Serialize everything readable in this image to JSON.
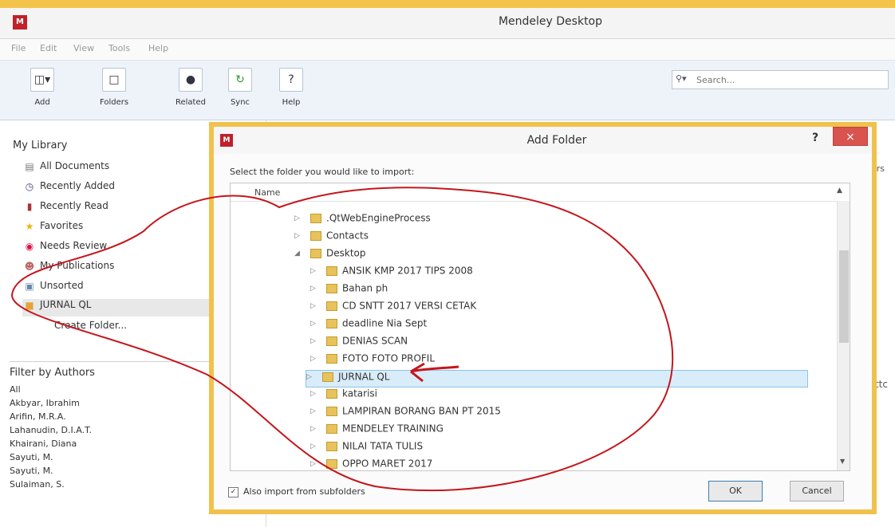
{
  "window": {
    "title": "Mendeley Desktop",
    "logo": "M"
  },
  "menu": [
    "File",
    "Edit",
    "View",
    "Tools",
    "Help"
  ],
  "toolbar": {
    "buttons": [
      {
        "label": "Add",
        "icon": "add-document-icon"
      },
      {
        "label": "Folders",
        "icon": "folder-icon"
      },
      {
        "label": "Related",
        "icon": "related-icon"
      },
      {
        "label": "Sync",
        "icon": "sync-icon"
      },
      {
        "label": "Help",
        "icon": "help-icon"
      }
    ],
    "search_placeholder": "Search..."
  },
  "sidebar": {
    "title": "My Library",
    "items": [
      {
        "label": "All Documents",
        "icon": "documents-icon"
      },
      {
        "label": "Recently Added",
        "icon": "clock-icon"
      },
      {
        "label": "Recently Read",
        "icon": "book-icon"
      },
      {
        "label": "Favorites",
        "icon": "star-icon"
      },
      {
        "label": "Needs Review",
        "icon": "review-icon"
      },
      {
        "label": "My Publications",
        "icon": "person-icon"
      },
      {
        "label": "Unsorted",
        "icon": "unsorted-icon"
      },
      {
        "label": "JURNAL QL",
        "icon": "folder-icon",
        "selected": true
      },
      {
        "label": "Create Folder...",
        "icon": ""
      }
    ]
  },
  "filter": {
    "title": "Filter by Authors",
    "authors": [
      "All",
      "Akbyar, Ibrahim",
      "Arifin, M.R.A.",
      "Lahanudin, D.I.A.T.",
      "Khairani, Diana",
      "Sayuti, M.",
      "Sayuti, M.",
      "Sulaiman, S."
    ]
  },
  "main": {
    "col_text": "ers",
    "col_text2": "rttc"
  },
  "dialog": {
    "title": "Add Folder",
    "logo": "M",
    "help": "?",
    "close": "×",
    "instruction": "Select the folder you would like to import:",
    "column_header": "Name",
    "tree": [
      {
        "label": ".QtWebEngineProcess",
        "level": 1,
        "expanded": false
      },
      {
        "label": "Contacts",
        "level": 1,
        "expanded": false
      },
      {
        "label": "Desktop",
        "level": 1,
        "expanded": true
      },
      {
        "label": "ANSIK KMP 2017 TIPS 2008",
        "level": 2,
        "expanded": false
      },
      {
        "label": "Bahan ph",
        "level": 2,
        "expanded": false
      },
      {
        "label": "CD SNTT 2017 VERSI CETAK",
        "level": 2,
        "expanded": false
      },
      {
        "label": "deadline Nia Sept",
        "level": 2,
        "expanded": false
      },
      {
        "label": "DENIAS SCAN",
        "level": 2,
        "expanded": false
      },
      {
        "label": "FOTO FOTO PROFIL",
        "level": 2,
        "expanded": false
      },
      {
        "label": "JURNAL QL",
        "level": 2,
        "expanded": false,
        "selected": true
      },
      {
        "label": "katarisi",
        "level": 2,
        "expanded": false
      },
      {
        "label": "LAMPIRAN BORANG BAN PT 2015",
        "level": 2,
        "expanded": false
      },
      {
        "label": "MENDELEY TRAINING",
        "level": 2,
        "expanded": false
      },
      {
        "label": "NILAI TATA TULIS",
        "level": 2,
        "expanded": false
      },
      {
        "label": "OPPO MARET 2017",
        "level": 2,
        "expanded": false
      }
    ],
    "checkbox_label": "Also import from subfolders",
    "checkbox_checked": true,
    "ok_label": "OK",
    "cancel_label": "Cancel"
  },
  "colors": {
    "title_strip": "#f3c44a",
    "logo_red": "#c0202a",
    "close_red": "#d9534f",
    "annotation": "#c4161c",
    "selection": "#d9ecf9"
  }
}
